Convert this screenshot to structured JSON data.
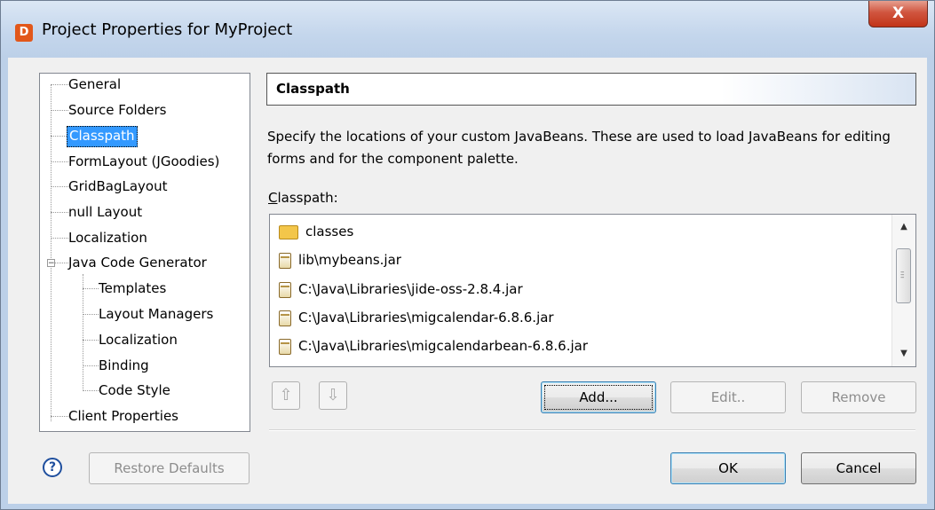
{
  "window": {
    "title": "Project Properties for MyProject",
    "close_label": "X",
    "app_icon_glyph": "D"
  },
  "tree": {
    "items": [
      {
        "label": "General"
      },
      {
        "label": "Source Folders"
      },
      {
        "label": "Classpath",
        "selected": true
      },
      {
        "label": "FormLayout (JGoodies)"
      },
      {
        "label": "GridBagLayout"
      },
      {
        "label": "null Layout"
      },
      {
        "label": "Localization"
      },
      {
        "label": "Java Code Generator",
        "expanded": true
      },
      {
        "label": "Templates"
      },
      {
        "label": "Layout Managers"
      },
      {
        "label": "Localization"
      },
      {
        "label": "Binding"
      },
      {
        "label": "Code Style"
      },
      {
        "label": "Client Properties"
      }
    ]
  },
  "main": {
    "header": "Classpath",
    "description": "Specify the locations of your custom JavaBeans. These are used to load JavaBeans for editing forms and for the component palette.",
    "classpath_label": "Classpath:",
    "classpath_items": [
      {
        "label": "classes",
        "icon": "folder-icon"
      },
      {
        "label": "lib\\mybeans.jar",
        "icon": "jar-icon"
      },
      {
        "label": "C:\\Java\\Libraries\\jide-oss-2.8.4.jar",
        "icon": "jar-icon"
      },
      {
        "label": "C:\\Java\\Libraries\\migcalendar-6.8.6.jar",
        "icon": "jar-icon"
      },
      {
        "label": "C:\\Java\\Libraries\\migcalendarbean-6.8.6.jar",
        "icon": "jar-icon"
      }
    ]
  },
  "buttons": {
    "move_up_icon": "arrow-up-icon",
    "move_down_icon": "arrow-down-icon",
    "add": "Add...",
    "edit": "Edit..",
    "remove": "Remove",
    "restore_defaults": "Restore Defaults",
    "ok": "OK",
    "cancel": "Cancel",
    "help": "?"
  },
  "colors": {
    "selection": "#3399ff",
    "close_button": "#c23418",
    "app_icon": "#e2571a",
    "window_frame": "#bcd0e8"
  }
}
